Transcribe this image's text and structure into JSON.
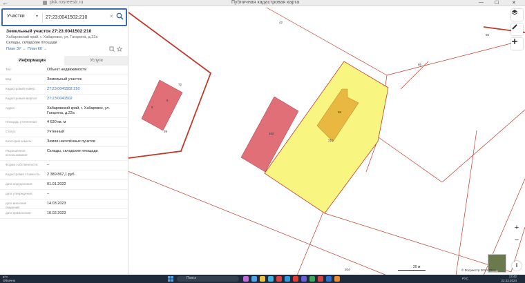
{
  "browser": {
    "back_glyph": "←",
    "url": "pkk.rosreestr.ru",
    "tab_title": "Публичная кадастровая карта",
    "minimize": "—",
    "maximize": "☐",
    "close": "✕"
  },
  "search": {
    "category": "Участки",
    "caret": "▾",
    "query": "27:23:0041502:210",
    "clear_glyph": "×"
  },
  "object": {
    "title": "Земельный участок 27:23:0041502:210",
    "address": "Хабаровский край, г. Хабаровск, ул. Гагарина, д.22а",
    "use": "Склады, складские площади",
    "plan_zu": "План ЗУ →",
    "plan_kk": "План КК →"
  },
  "tabs": {
    "info": "Информация",
    "services": "Услуги"
  },
  "rows": [
    {
      "label": "Тип:",
      "value": "Объект недвижимости",
      "link": false
    },
    {
      "label": "Вид:",
      "value": "Земельный участок",
      "link": false
    },
    {
      "label": "Кадастровый номер:",
      "value": "27:23:0041502:210",
      "link": true
    },
    {
      "label": "Кадастровый квартал:",
      "value": "27:23:0041502",
      "link": true
    },
    {
      "label": "Адрес:",
      "value": "Хабаровский край, г. Хабаровск, ул. Гагарина, д.22а",
      "link": false
    },
    {
      "label": "Площадь уточненная:",
      "value": "4 630 кв. м",
      "link": false
    },
    {
      "label": "Статус:",
      "value": "Учтенный",
      "link": false
    },
    {
      "label": "Категория земель:",
      "value": "Земли населённых пунктов",
      "link": false
    },
    {
      "label": "Разрешенное использование:",
      "value": "Склады, складские площади",
      "link": false
    },
    {
      "label": "Форма собственности:",
      "value": "–",
      "link": false
    },
    {
      "label": "Кадастровая стоимость:",
      "value": "2 389 867,1 руб.",
      "link": false
    },
    {
      "label": "дата определения:",
      "value": "01.01.2022",
      "link": false
    },
    {
      "label": "дата утверждения:",
      "value": "–",
      "link": false
    },
    {
      "label": "дата внесения сведений:",
      "value": "14.03.2023",
      "link": false
    },
    {
      "label": "дата применения:",
      "value": "10.02.2023",
      "link": false
    }
  ],
  "map": {
    "parcel_labels": [
      "42",
      "66",
      "86",
      "72",
      "39",
      "210",
      "204",
      "5"
    ],
    "building_labels": [
      "6",
      "162",
      "96"
    ],
    "zoom_in": "+",
    "zoom_out": "−",
    "scale": "20 м",
    "copyright": "© Росреестр 2010-2024",
    "info_glyph": "i",
    "minimap_label": "Снимок"
  },
  "colors": {
    "selected_parcel": "#f8f580",
    "building": "#e06f78",
    "selected_building": "#e8b840",
    "boundary": "#c0392b",
    "accent": "#3a6ab0"
  },
  "taskbar": {
    "weather_temp": "8°C",
    "weather_text": "Облачно",
    "search_placeholder": "Поиск",
    "lang": "РУС",
    "time": "13:42",
    "date": "22.03.2024"
  }
}
